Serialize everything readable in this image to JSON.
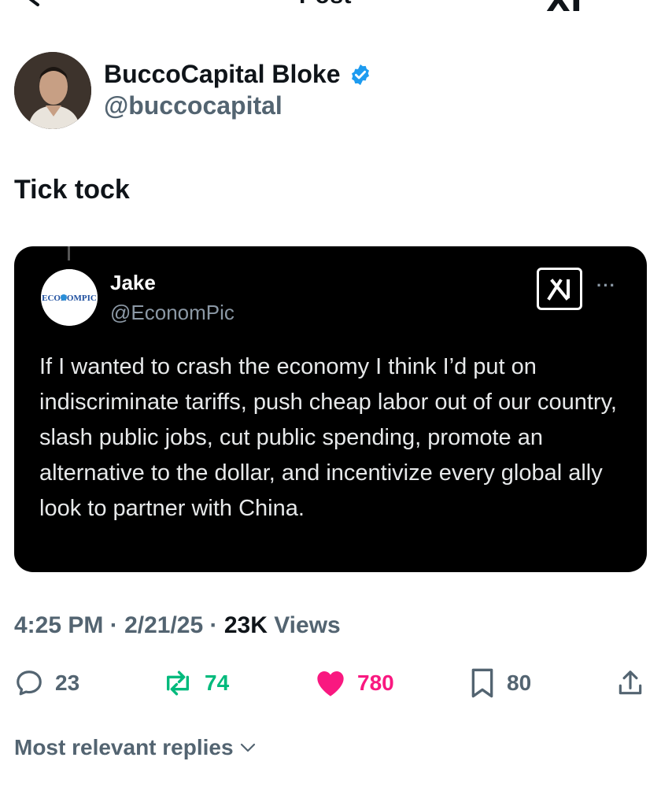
{
  "header": {
    "title": "Post",
    "grok_label": "XI",
    "more": "···"
  },
  "author": {
    "name": "BuccoCapital Bloke",
    "handle": "@buccocapital",
    "verified": true
  },
  "tweet": {
    "text": "Tick tock"
  },
  "quote": {
    "avatar_text": "ECONOMPIC",
    "name": "Jake",
    "handle": "@EconomPic",
    "body": "If I wanted to crash the economy I think I’d put on indiscriminate tariffs, push cheap labor out of our country, slash public jobs, cut public spending, promote an alternative to the dollar, and incentivize every global ally look to partner with China.",
    "more": "···"
  },
  "meta": {
    "time": "4:25 PM",
    "date": "2/21/25",
    "views_count": "23K",
    "views_label": "Views"
  },
  "actions": {
    "replies": "23",
    "reposts": "74",
    "likes": "780",
    "bookmarks": "80"
  },
  "replies_sort": {
    "label": "Most relevant replies"
  },
  "colors": {
    "verified": "#1d9bf0",
    "repost": "#00ba7c",
    "like": "#f91880",
    "muted": "#536471"
  }
}
